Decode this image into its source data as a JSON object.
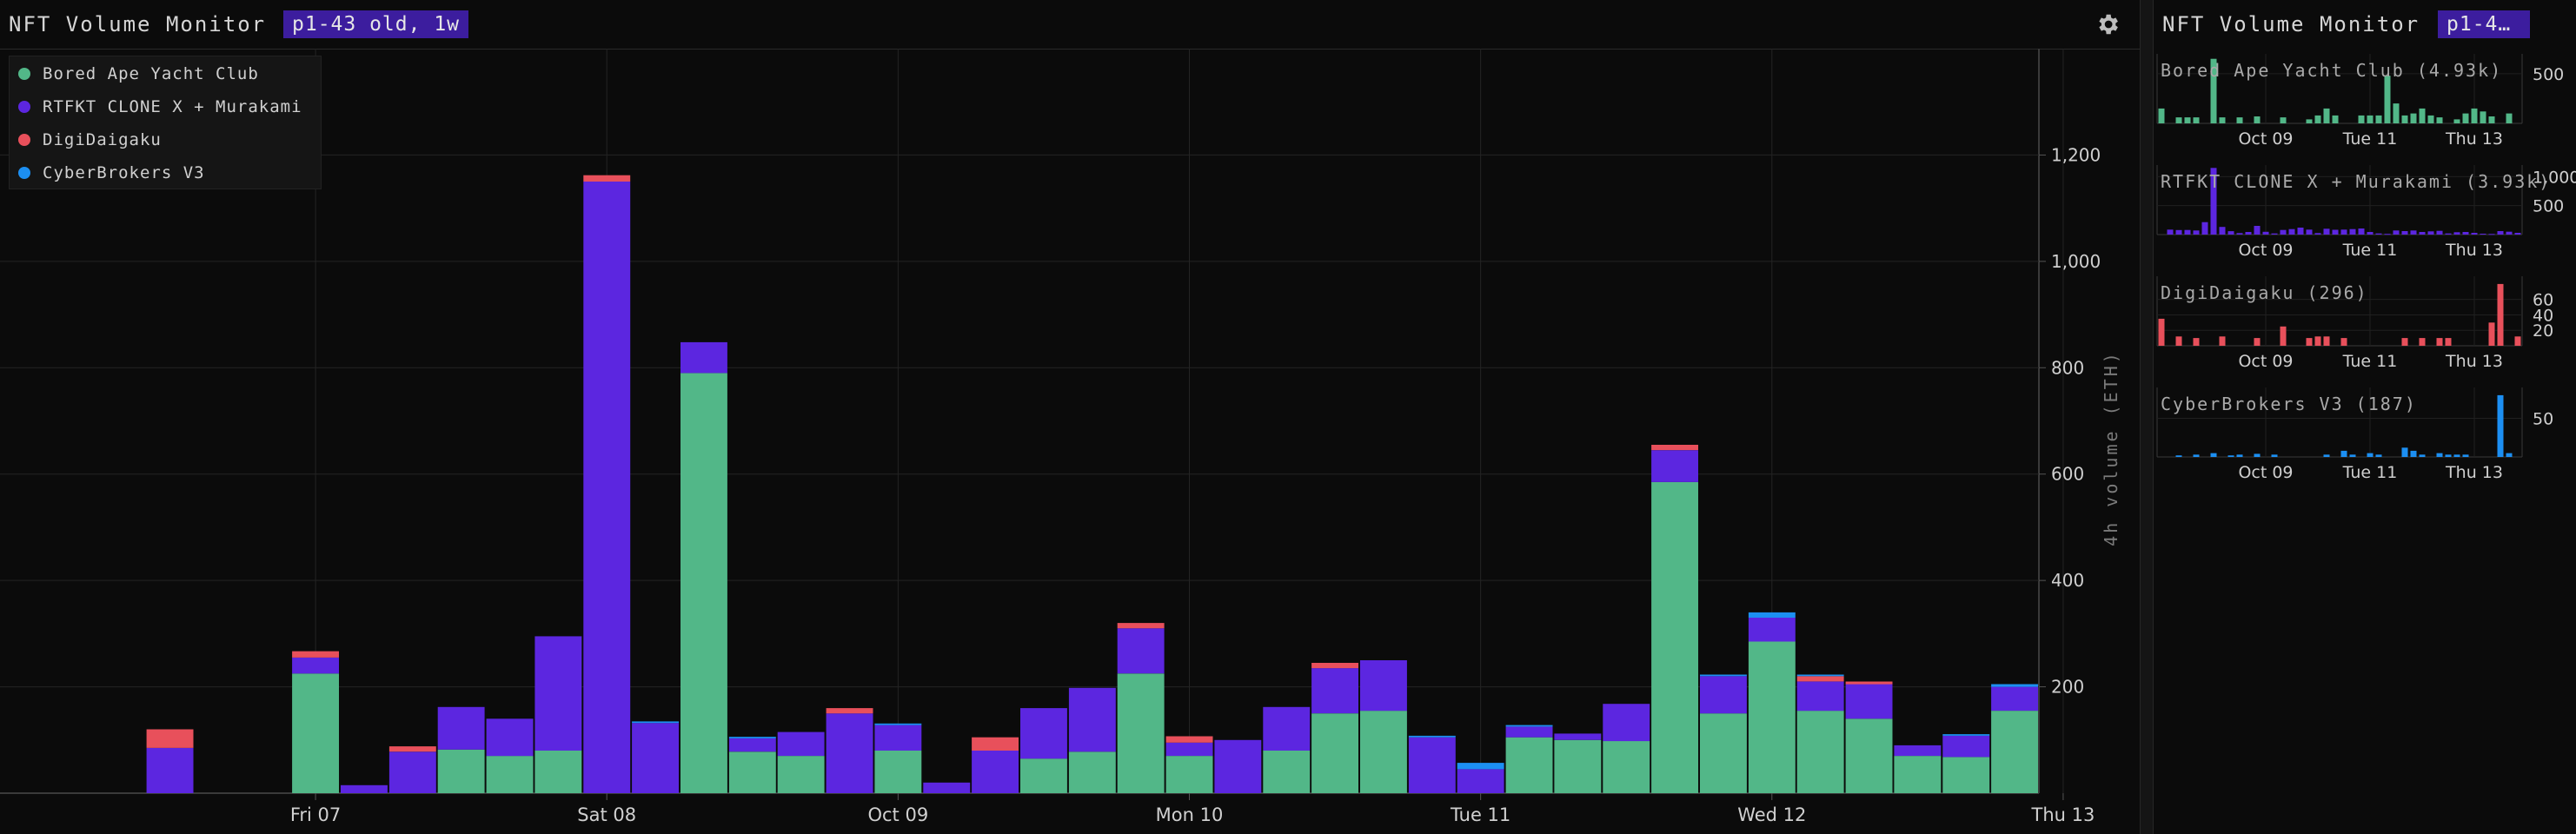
{
  "app": {
    "title": "NFT Volume Monitor",
    "badge": "p1-43 old, 1w",
    "settings_icon": "gear-icon"
  },
  "colors": {
    "background": "#0b0b0b",
    "grid": "#242424",
    "badge": "#3c1d9e",
    "bayc": "#52b788",
    "clonex": "#5c26e0",
    "digi": "#e8505b",
    "cyber": "#1c8ff2"
  },
  "legend": [
    {
      "label": "Bored Ape Yacht Club",
      "color": "#52b788"
    },
    {
      "label": "RTFKT CLONE X + Murakami",
      "color": "#5c26e0"
    },
    {
      "label": "DigiDaigaku",
      "color": "#e8505b"
    },
    {
      "label": "CyberBrokers V3",
      "color": "#1c8ff2"
    }
  ],
  "chart_data": [
    {
      "type": "bar",
      "stacked": true,
      "title": "",
      "ylabel": "4h volume (ETH)",
      "ylim": [
        0,
        1400
      ],
      "yticks": [
        200,
        400,
        600,
        800,
        1000,
        1200
      ],
      "ytick_labels": [
        "200",
        "400",
        "600",
        "800",
        "1,000",
        "1,200"
      ],
      "x_tick_labels": [
        "Fri 07",
        "Sat 08",
        "Oct 09",
        "Mon 10",
        "Tue 11",
        "Wed 12",
        "Thu 13"
      ],
      "grid": true,
      "legend_position": "top-left",
      "bar_count": 42,
      "series": [
        {
          "name": "Bored Ape Yacht Club",
          "color": "#52b788",
          "values": [
            0,
            0,
            0,
            0,
            0,
            0,
            225,
            0,
            0,
            82,
            70,
            80,
            0,
            0,
            790,
            78,
            70,
            0,
            80,
            0,
            0,
            65,
            78,
            225,
            70,
            0,
            80,
            150,
            155,
            0,
            0,
            105,
            100,
            98,
            585,
            150,
            285,
            155,
            140,
            70,
            68,
            155
          ]
        },
        {
          "name": "RTFKT CLONE X + Murakami",
          "color": "#5c26e0",
          "values": [
            0,
            0,
            0,
            85,
            0,
            0,
            30,
            15,
            78,
            80,
            70,
            215,
            1150,
            132,
            58,
            25,
            45,
            150,
            48,
            20,
            80,
            95,
            120,
            85,
            25,
            100,
            82,
            85,
            95,
            105,
            45,
            20,
            12,
            70,
            60,
            70,
            45,
            55,
            65,
            20,
            40,
            45
          ]
        },
        {
          "name": "DigiDaigaku",
          "color": "#e8505b",
          "values": [
            0,
            0,
            0,
            35,
            0,
            0,
            12,
            0,
            10,
            0,
            0,
            0,
            12,
            0,
            0,
            0,
            0,
            10,
            0,
            0,
            25,
            0,
            0,
            10,
            12,
            0,
            0,
            10,
            0,
            0,
            0,
            0,
            0,
            0,
            10,
            0,
            0,
            10,
            5,
            0,
            0,
            0
          ]
        },
        {
          "name": "CyberBrokers V3",
          "color": "#1c8ff2",
          "values": [
            0,
            0,
            0,
            0,
            0,
            0,
            0,
            0,
            0,
            0,
            0,
            0,
            0,
            3,
            0,
            3,
            0,
            0,
            3,
            0,
            0,
            0,
            0,
            0,
            0,
            0,
            0,
            0,
            0,
            3,
            12,
            3,
            0,
            0,
            0,
            3,
            10,
            3,
            0,
            0,
            3,
            5
          ]
        }
      ]
    },
    {
      "type": "bar",
      "title": "Bored Ape Yacht Club (4.93k)",
      "color": "#52b788",
      "ylim": [
        0,
        700
      ],
      "yticks": [
        500
      ],
      "ytick_labels": [
        "500"
      ],
      "x_tick_labels": [
        "Oct 09",
        "Tue 11",
        "Thu 13"
      ],
      "values": [
        150,
        0,
        60,
        60,
        60,
        0,
        650,
        60,
        0,
        60,
        0,
        70,
        0,
        0,
        60,
        0,
        0,
        40,
        80,
        150,
        80,
        0,
        0,
        80,
        80,
        80,
        480,
        200,
        80,
        100,
        150,
        80,
        60,
        0,
        40,
        100,
        150,
        120,
        70,
        0,
        100,
        0
      ]
    },
    {
      "type": "bar",
      "title": "RTFKT CLONE X + Murakami (3.93k)",
      "color": "#5c26e0",
      "ylim": [
        0,
        1200
      ],
      "yticks": [
        500,
        1000
      ],
      "ytick_labels": [
        "500",
        "1,000"
      ],
      "x_tick_labels": [
        "Oct 09",
        "Tue 11",
        "Thu 13"
      ],
      "values": [
        0,
        85,
        78,
        80,
        70,
        215,
        1150,
        132,
        58,
        25,
        45,
        150,
        48,
        20,
        80,
        95,
        120,
        85,
        25,
        100,
        82,
        85,
        95,
        105,
        45,
        20,
        12,
        70,
        60,
        70,
        45,
        55,
        65,
        20,
        40,
        45,
        30,
        15,
        10,
        60,
        50,
        30
      ]
    },
    {
      "type": "bar",
      "title": "DigiDaigaku (296)",
      "color": "#e8505b",
      "ylim": [
        0,
        90
      ],
      "yticks": [
        20,
        40,
        60
      ],
      "ytick_labels": [
        "20",
        "40",
        "60"
      ],
      "x_tick_labels": [
        "Oct 09",
        "Tue 11",
        "Thu 13"
      ],
      "values": [
        35,
        0,
        12,
        0,
        10,
        0,
        0,
        12,
        0,
        0,
        0,
        10,
        0,
        0,
        25,
        0,
        0,
        10,
        12,
        12,
        0,
        10,
        0,
        0,
        0,
        0,
        0,
        0,
        10,
        0,
        10,
        0,
        10,
        10,
        0,
        0,
        0,
        0,
        30,
        80,
        0,
        12
      ]
    },
    {
      "type": "bar",
      "title": "CyberBrokers V3 (187)",
      "color": "#1c8ff2",
      "ylim": [
        0,
        90
      ],
      "yticks": [
        50
      ],
      "ytick_labels": [
        "50"
      ],
      "x_tick_labels": [
        "Oct 09",
        "Tue 11",
        "Thu 13"
      ],
      "values": [
        0,
        0,
        2,
        0,
        3,
        0,
        5,
        0,
        2,
        3,
        0,
        4,
        0,
        3,
        0,
        0,
        0,
        0,
        0,
        3,
        0,
        8,
        3,
        0,
        5,
        3,
        0,
        0,
        12,
        8,
        3,
        0,
        5,
        3,
        3,
        3,
        0,
        0,
        0,
        80,
        5,
        0
      ]
    }
  ]
}
